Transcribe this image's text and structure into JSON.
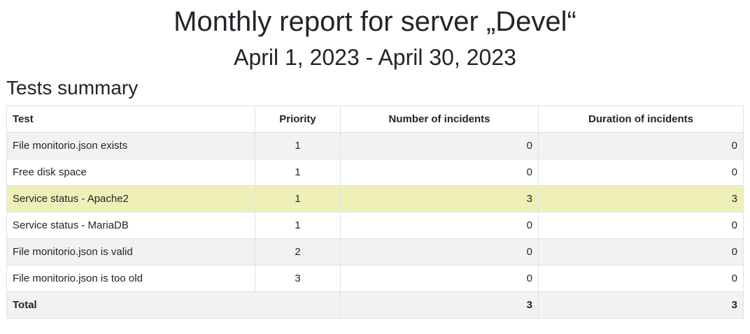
{
  "report": {
    "title": "Monthly report for server „Devel“",
    "period": "April 1, 2023 - April 30, 2023"
  },
  "summary": {
    "heading": "Tests summary",
    "columns": {
      "test": "Test",
      "priority": "Priority",
      "incidents": "Number of incidents",
      "duration": "Duration of incidents"
    },
    "rows": [
      {
        "test": "File monitorio.json exists",
        "priority": "1",
        "incidents": "0",
        "duration": "0"
      },
      {
        "test": "Free disk space",
        "priority": "1",
        "incidents": "0",
        "duration": "0"
      },
      {
        "test": "Service status - Apache2",
        "priority": "1",
        "incidents": "3",
        "duration": "3"
      },
      {
        "test": "Service status - MariaDB",
        "priority": "1",
        "incidents": "0",
        "duration": "0"
      },
      {
        "test": "File monitorio.json is valid",
        "priority": "2",
        "incidents": "0",
        "duration": "0"
      },
      {
        "test": "File monitorio.json is too old",
        "priority": "3",
        "incidents": "0",
        "duration": "0"
      }
    ],
    "total": {
      "label": "Total",
      "incidents": "3",
      "duration": "3"
    }
  },
  "colors": {
    "highlight_row": "#eff0b8",
    "striped_row": "#f2f2f2",
    "border": "#dee2e6"
  }
}
